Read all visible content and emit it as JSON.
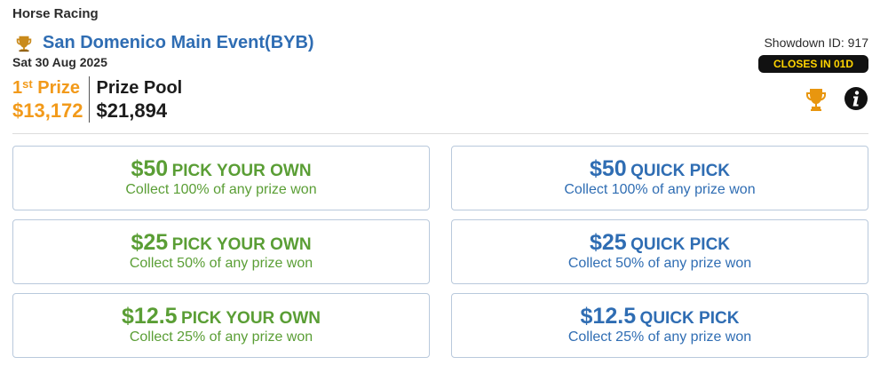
{
  "header": {
    "category": "Horse Racing",
    "event_title": "San Domenico Main Event(BYB)",
    "event_date": "Sat 30 Aug 2025",
    "showdown_id": "Showdown ID: 917",
    "closes_badge": "CLOSES IN 01D",
    "icons": {
      "title_icon": "trophy-icon",
      "leaderboard_icon": "trophy-icon",
      "info_icon": "info-icon"
    }
  },
  "prizes": {
    "first_prize_ordinal": "1",
    "first_prize_suffix": "st",
    "first_prize_word": "Prize",
    "first_prize_amount": "$13,172",
    "pool_label": "Prize Pool",
    "pool_amount": "$21,894"
  },
  "colors": {
    "title_blue": "#2f6db3",
    "first_prize_orange": "#f29a1a",
    "pick_green": "#5a9e35",
    "badge_bg": "#111111",
    "badge_text": "#ffd400"
  },
  "options": {
    "pick_your_own": [
      {
        "amount": "$50",
        "label": "PICK YOUR OWN",
        "desc": "Collect 100% of any prize won"
      },
      {
        "amount": "$25",
        "label": "PICK YOUR OWN",
        "desc": "Collect 50% of any prize won"
      },
      {
        "amount": "$12.5",
        "label": "PICK YOUR OWN",
        "desc": "Collect 25% of any prize won"
      }
    ],
    "quick_pick": [
      {
        "amount": "$50",
        "label": "QUICK PICK",
        "desc": "Collect 100% of any prize won"
      },
      {
        "amount": "$25",
        "label": "QUICK PICK",
        "desc": "Collect 50% of any prize won"
      },
      {
        "amount": "$12.5",
        "label": "QUICK PICK",
        "desc": "Collect 25% of any prize won"
      }
    ]
  }
}
